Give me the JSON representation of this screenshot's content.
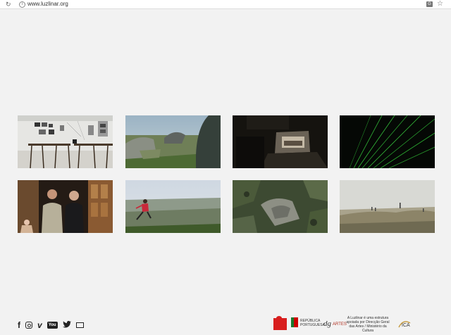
{
  "browser": {
    "url": "www.luzlinar.org"
  },
  "gallery": {
    "tiles": [
      {
        "subject": "studio-tables-photo"
      },
      {
        "subject": "rocky-landscape-photo"
      },
      {
        "subject": "dark-theater-photo"
      },
      {
        "subject": "green-laser-photo"
      },
      {
        "subject": "two-men-portrait-photo"
      },
      {
        "subject": "jumping-figure-photo"
      },
      {
        "subject": "aerial-rocks-photo"
      },
      {
        "subject": "hillside-figures-photo"
      }
    ]
  },
  "footer": {
    "social_icons": [
      "facebook-icon",
      "instagram-icon",
      "vimeo-icon",
      "youtube-icon",
      "twitter-icon",
      "mail-icon"
    ],
    "republica_text": "REPÚBLICA PORTUGUESA",
    "dgartes_label": "dg ARTES",
    "sponsor_note": "A Luzlinar é uma estrutura apoiada por Direcção Geral das Artes / Ministério da Cultura",
    "ica_label": "ICA"
  }
}
